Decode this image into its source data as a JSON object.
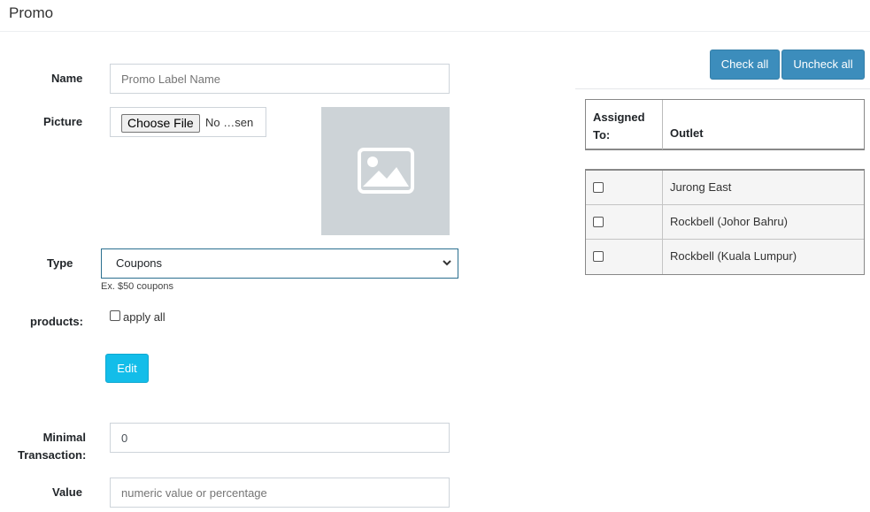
{
  "page": {
    "title": "Promo"
  },
  "form": {
    "name": {
      "label": "Name",
      "placeholder": "Promo Label Name"
    },
    "picture": {
      "label": "Picture",
      "button": "Choose File",
      "status": "No …sen"
    },
    "type": {
      "label": "Type",
      "selected": "Coupons",
      "hint": "Ex. $50 coupons"
    },
    "products": {
      "label": "products:",
      "checkbox_label": "apply all"
    },
    "edit_button": "Edit",
    "minimal": {
      "label_line1": "Minimal",
      "label_line2": "Transaction:",
      "value": "0"
    },
    "value": {
      "label": "Value",
      "placeholder": "numeric value or percentage"
    }
  },
  "outlets": {
    "check_all": "Check all",
    "uncheck_all": "Uncheck all",
    "headers": {
      "assigned_line1": "Assigned",
      "assigned_line2": "To:",
      "outlet": "Outlet"
    },
    "rows": [
      {
        "name": "Jurong East",
        "checked": false
      },
      {
        "name": "Rockbell (Johor Bahru)",
        "checked": false
      },
      {
        "name": "Rockbell (Kuala Lumpur)",
        "checked": false
      }
    ]
  },
  "colors": {
    "primary": "#3c8dbc",
    "info": "#13bde9",
    "placeholder_bg": "#cdd3d7"
  }
}
